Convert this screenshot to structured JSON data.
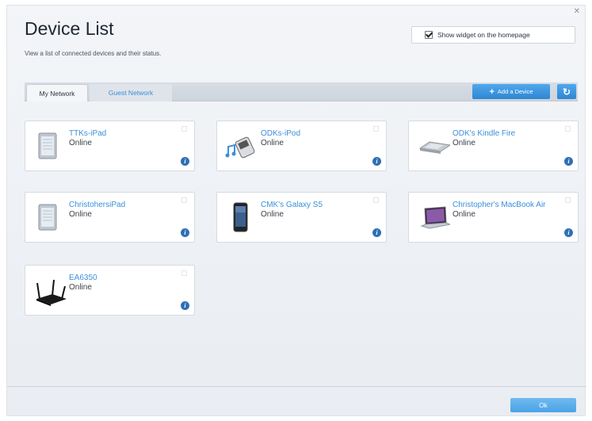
{
  "header": {
    "title": "Device List",
    "subtitle": "View a list of connected devices and their status.",
    "widget_label": "Show widget on the homepage",
    "widget_checked": true
  },
  "tabs": {
    "my_network": "My Network",
    "guest_network": "Guest Network"
  },
  "actions": {
    "add_device": "Add a Device",
    "refresh_icon": "refresh-icon"
  },
  "devices": [
    {
      "name": "TTKs-iPad",
      "status": "Online",
      "icon": "tablet-icon"
    },
    {
      "name": "ODKs-iPod",
      "status": "Online",
      "icon": "music-player-icon"
    },
    {
      "name": "ODK's Kindle Fire",
      "status": "Online",
      "icon": "kindle-icon"
    },
    {
      "name": "ChristohersiPad",
      "status": "Online",
      "icon": "tablet-icon"
    },
    {
      "name": "CMK's Galaxy S5",
      "status": "Online",
      "icon": "phone-icon"
    },
    {
      "name": "Christopher's MacBook Air",
      "status": "Online",
      "icon": "laptop-icon"
    },
    {
      "name": "EA6350",
      "status": "Online",
      "icon": "router-icon"
    }
  ],
  "footer": {
    "ok": "Ok"
  },
  "colors": {
    "accent": "#3b8fda",
    "button": "#2e86d3",
    "info": "#2f6fb5"
  }
}
